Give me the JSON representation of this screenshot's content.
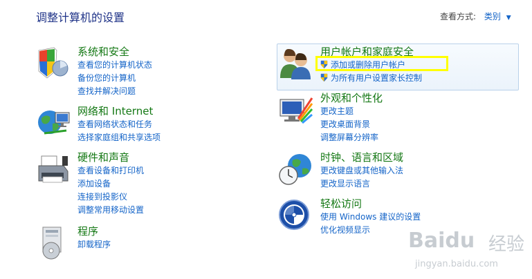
{
  "header": {
    "title": "调整计算机的设置",
    "view_by_label": "查看方式:",
    "view_by_value": "类别"
  },
  "categories": [
    {
      "id": "system-security",
      "title": "系统和安全",
      "icon": "shield-chart-icon",
      "links": [
        "查看您的计算机状态",
        "备份您的计算机",
        "查找并解决问题"
      ]
    },
    {
      "id": "network-internet",
      "title": "网络和 Internet",
      "icon": "globe-network-icon",
      "links": [
        "查看网络状态和任务",
        "选择家庭组和共享选项"
      ]
    },
    {
      "id": "hardware-sound",
      "title": "硬件和声音",
      "icon": "printer-icon",
      "links": [
        "查看设备和打印机",
        "添加设备",
        "连接到投影仪",
        "调整常用移动设置"
      ]
    },
    {
      "id": "programs",
      "title": "程序",
      "icon": "programs-disc-icon",
      "links": [
        "卸载程序"
      ]
    },
    {
      "id": "user-accounts",
      "title": "用户帐户和家庭安全",
      "icon": "users-icon",
      "links": [
        "添加或删除用户帐户",
        "为所有用户设置家长控制"
      ]
    },
    {
      "id": "appearance",
      "title": "外观和个性化",
      "icon": "monitor-palette-icon",
      "links": [
        "更改主题",
        "更改桌面背景",
        "调整屏幕分辨率"
      ]
    },
    {
      "id": "clock-language",
      "title": "时钟、语言和区域",
      "icon": "globe-clock-icon",
      "links": [
        "更改键盘或其他输入法",
        "更改显示语言"
      ]
    },
    {
      "id": "ease-of-access",
      "title": "轻松访问",
      "icon": "ease-of-access-icon",
      "links": [
        "使用 Windows 建议的设置",
        "优化视频显示"
      ]
    }
  ],
  "watermark": {
    "brand": "Baidu",
    "cn": "经验",
    "url": "jingyan.baidu.com"
  },
  "colors": {
    "title": "#1e3287",
    "category_title": "#147814",
    "link": "#1464c8",
    "highlight": "#ffff00"
  }
}
